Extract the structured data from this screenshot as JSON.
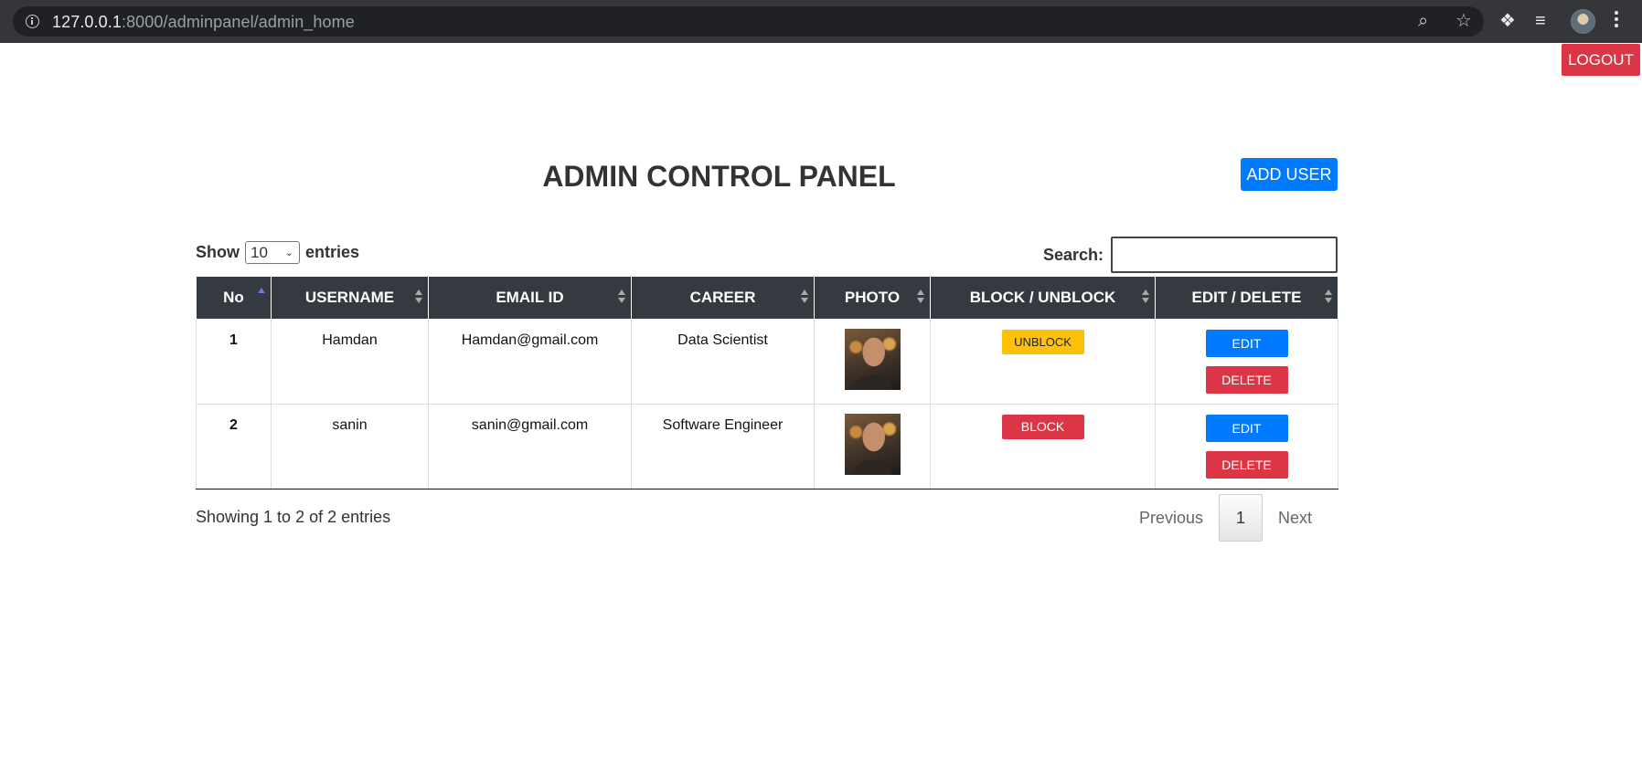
{
  "browser": {
    "url_host": "127.0.0.1",
    "url_path": ":8000/adminpanel/admin_home"
  },
  "header": {
    "logout_label": "LOGOUT",
    "title": "ADMIN CONTROL PANEL",
    "add_user_label": "ADD USER"
  },
  "controls": {
    "show_label": "Show",
    "entries_value": "10",
    "entries_label": "entries",
    "search_label": "Search:",
    "search_value": ""
  },
  "table": {
    "columns": [
      "No",
      "USERNAME",
      "EMAIL ID",
      "CAREER",
      "PHOTO",
      "BLOCK / UNBLOCK",
      "EDIT / DELETE"
    ],
    "rows": [
      {
        "no": "1",
        "username": "Hamdan",
        "email": "Hamdan@gmail.com",
        "career": "Data Scientist",
        "status_action": "UNBLOCK",
        "edit": "EDIT",
        "delete": "DELETE"
      },
      {
        "no": "2",
        "username": "sanin",
        "email": "sanin@gmail.com",
        "career": "Software Engineer",
        "status_action": "BLOCK",
        "edit": "EDIT",
        "delete": "DELETE"
      }
    ]
  },
  "footer": {
    "info": "Showing 1 to 2 of 2 entries",
    "previous": "Previous",
    "page": "1",
    "next": "Next"
  },
  "colors": {
    "primary": "#007bff",
    "danger": "#dc3545",
    "warning": "#ffc107",
    "header_dark": "#343a40"
  }
}
